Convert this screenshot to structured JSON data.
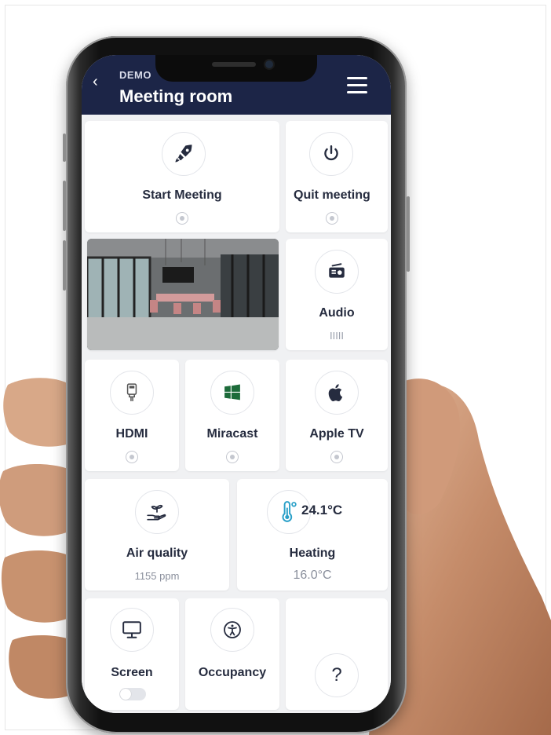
{
  "header": {
    "subtitle": "DEMO",
    "title": "Meeting room",
    "back_icon": "chevron-left-icon",
    "menu_icon": "hamburger-menu-icon"
  },
  "tiles": {
    "start_meeting": {
      "label": "Start Meeting",
      "icon": "rocket-icon"
    },
    "quit_meeting": {
      "label": "Quit meeting",
      "icon": "power-icon"
    },
    "audio": {
      "label": "Audio",
      "level_text": "IIIII",
      "icon": "radio-icon"
    },
    "hdmi": {
      "label": "HDMI",
      "icon": "hdmi-icon"
    },
    "miracast": {
      "label": "Miracast",
      "icon": "windows-icon",
      "icon_color": "#1d6b3a"
    },
    "apple_tv": {
      "label": "Apple TV",
      "icon": "apple-icon"
    },
    "air_quality": {
      "label": "Air quality",
      "value": "1155 ppm",
      "icon": "plant-hand-icon"
    },
    "heating": {
      "label": "Heating",
      "current": "24.1°C",
      "setpoint": "16.0°C",
      "icon": "thermometer-icon",
      "icon_color": "#2aa0c8"
    },
    "screen": {
      "label": "Screen",
      "toggle_on": false,
      "icon": "monitor-icon"
    },
    "occupancy": {
      "label": "Occupancy",
      "icon": "accessibility-icon"
    },
    "help": {
      "glyph": "?",
      "icon": "question-icon"
    }
  },
  "colors": {
    "header_bg": "#1c2547",
    "text_dark": "#262c3f",
    "muted": "#8a8f9c"
  }
}
